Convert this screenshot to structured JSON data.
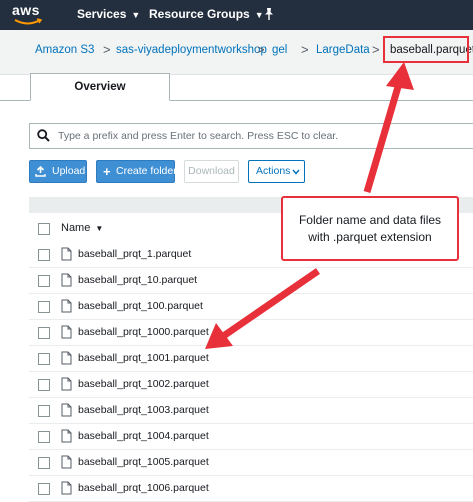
{
  "topbar": {
    "logo": "aws",
    "services_label": "Services",
    "resource_groups_label": "Resource Groups"
  },
  "breadcrumb": {
    "items": [
      "Amazon S3",
      "sas-viyadeploymentworkshop",
      "gel",
      "LargeData"
    ],
    "current": "baseball.parquet",
    "separator": ">"
  },
  "tabs": [
    {
      "label": "Overview",
      "active": true
    }
  ],
  "search": {
    "placeholder": "Type a prefix and press Enter to search. Press ESC to clear."
  },
  "toolbar": {
    "upload_label": "Upload",
    "create_folder_label": "Create folder",
    "download_label": "Download",
    "actions_label": "Actions"
  },
  "table": {
    "name_header": "Name",
    "files": [
      "baseball_prqt_1.parquet",
      "baseball_prqt_10.parquet",
      "baseball_prqt_100.parquet",
      "baseball_prqt_1000.parquet",
      "baseball_prqt_1001.parquet",
      "baseball_prqt_1002.parquet",
      "baseball_prqt_1003.parquet",
      "baseball_prqt_1004.parquet",
      "baseball_prqt_1005.parquet",
      "baseball_prqt_1006.parquet"
    ]
  },
  "annotation": {
    "line1": "Folder name and data files",
    "line2": "with .parquet extension",
    "color": "#e8303a"
  },
  "colors": {
    "header_bg": "#232f3e",
    "primary": "#3f8fd4",
    "link": "#0073bb"
  }
}
